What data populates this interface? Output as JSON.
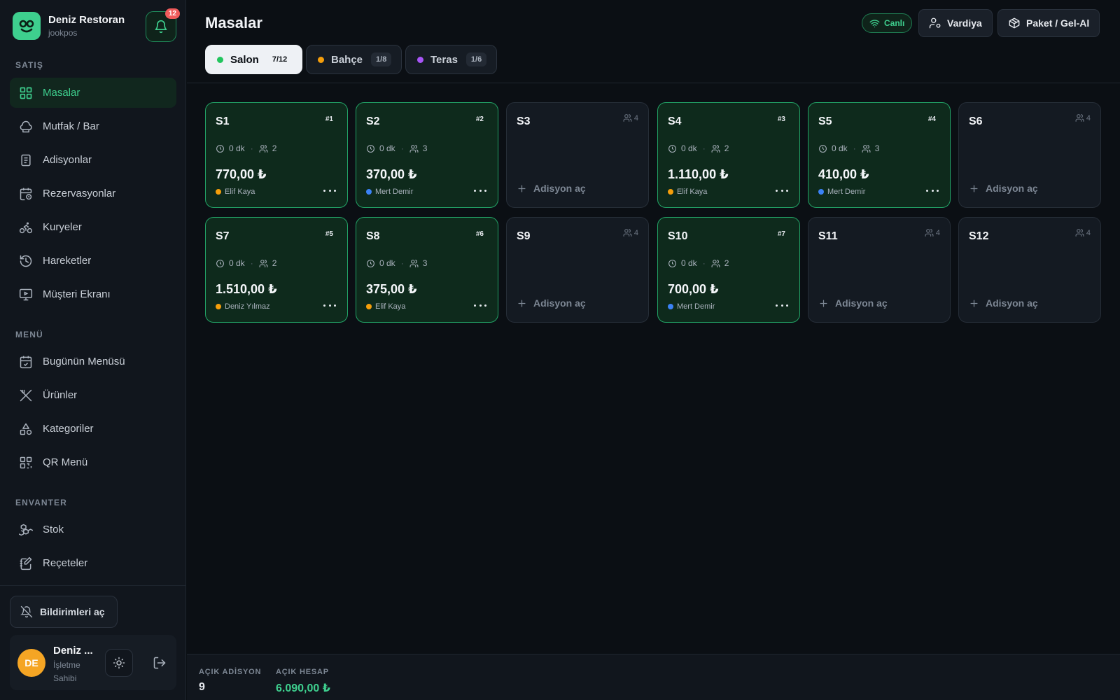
{
  "brand": {
    "name": "Deniz Restoran",
    "subtitle": "jookpos",
    "notification_count": "12"
  },
  "sidebar": {
    "sections": [
      {
        "title": "SATIŞ",
        "items": [
          {
            "label": "Masalar",
            "icon": "grid-icon",
            "active": true
          },
          {
            "label": "Mutfak / Bar",
            "icon": "chef-hat-icon"
          },
          {
            "label": "Adisyonlar",
            "icon": "receipt-icon"
          },
          {
            "label": "Rezervasyonlar",
            "icon": "calendar-clock-icon"
          },
          {
            "label": "Kuryeler",
            "icon": "bike-icon"
          },
          {
            "label": "Hareketler",
            "icon": "history-icon"
          },
          {
            "label": "Müşteri Ekranı",
            "icon": "monitor-icon"
          }
        ]
      },
      {
        "title": "MENÜ",
        "items": [
          {
            "label": "Bugünün Menüsü",
            "icon": "calendar-check-icon"
          },
          {
            "label": "Ürünler",
            "icon": "utensils-crossed-icon"
          },
          {
            "label": "Kategoriler",
            "icon": "shapes-icon"
          },
          {
            "label": "QR Menü",
            "icon": "qr-code-icon"
          }
        ]
      },
      {
        "title": "ENVANTER",
        "items": [
          {
            "label": "Stok",
            "icon": "boxes-icon"
          },
          {
            "label": "Reçeteler",
            "icon": "notebook-pen-icon"
          }
        ]
      }
    ],
    "notifications_button": "Bildirimleri aç",
    "user": {
      "initials": "DE",
      "name": "Deniz ...",
      "role": "İşletme Sahibi"
    }
  },
  "header": {
    "title": "Masalar",
    "live_label": "Canlı",
    "shift_button": "Vardiya",
    "takeaway_button": "Paket / Gel-Al",
    "zones": [
      {
        "label": "Salon",
        "count": "7/12",
        "color": "#22c55e",
        "active": true
      },
      {
        "label": "Bahçe",
        "count": "1/8",
        "color": "#f59e0b"
      },
      {
        "label": "Teras",
        "count": "1/6",
        "color": "#a855f7"
      }
    ]
  },
  "tables": [
    {
      "name": "S1",
      "status": "occupied",
      "ticket": "#1",
      "duration": "0 dk",
      "guests": "2",
      "amount": "770,00 ₺",
      "waiter": "Elif Kaya",
      "waiter_color": "#f59e0b"
    },
    {
      "name": "S2",
      "status": "occupied",
      "ticket": "#2",
      "duration": "0 dk",
      "guests": "3",
      "amount": "370,00 ₺",
      "waiter": "Mert Demir",
      "waiter_color": "#3b82f6"
    },
    {
      "name": "S3",
      "status": "free",
      "capacity": "4",
      "open_label": "Adisyon aç"
    },
    {
      "name": "S4",
      "status": "occupied",
      "ticket": "#3",
      "duration": "0 dk",
      "guests": "2",
      "amount": "1.110,00 ₺",
      "waiter": "Elif Kaya",
      "waiter_color": "#f59e0b"
    },
    {
      "name": "S5",
      "status": "occupied",
      "ticket": "#4",
      "duration": "0 dk",
      "guests": "3",
      "amount": "410,00 ₺",
      "waiter": "Mert Demir",
      "waiter_color": "#3b82f6"
    },
    {
      "name": "S6",
      "status": "free",
      "capacity": "4",
      "open_label": "Adisyon aç"
    },
    {
      "name": "S7",
      "status": "occupied",
      "ticket": "#5",
      "duration": "0 dk",
      "guests": "2",
      "amount": "1.510,00 ₺",
      "waiter": "Deniz Yılmaz",
      "waiter_color": "#f59e0b"
    },
    {
      "name": "S8",
      "status": "occupied",
      "ticket": "#6",
      "duration": "0 dk",
      "guests": "3",
      "amount": "375,00 ₺",
      "waiter": "Elif Kaya",
      "waiter_color": "#f59e0b"
    },
    {
      "name": "S9",
      "status": "free",
      "capacity": "4",
      "open_label": "Adisyon aç"
    },
    {
      "name": "S10",
      "status": "occupied",
      "ticket": "#7",
      "duration": "0 dk",
      "guests": "2",
      "amount": "700,00 ₺",
      "waiter": "Mert Demir",
      "waiter_color": "#3b82f6"
    },
    {
      "name": "S11",
      "status": "free",
      "capacity": "4",
      "open_label": "Adisyon aç"
    },
    {
      "name": "S12",
      "status": "free",
      "capacity": "4",
      "open_label": "Adisyon aç"
    }
  ],
  "footer": {
    "open_tickets_label": "AÇIK ADİSYON",
    "open_tickets_value": "9",
    "open_total_label": "AÇIK HESAP",
    "open_total_value": "6.090,00 ₺",
    "accent": "#3ecf8e"
  }
}
